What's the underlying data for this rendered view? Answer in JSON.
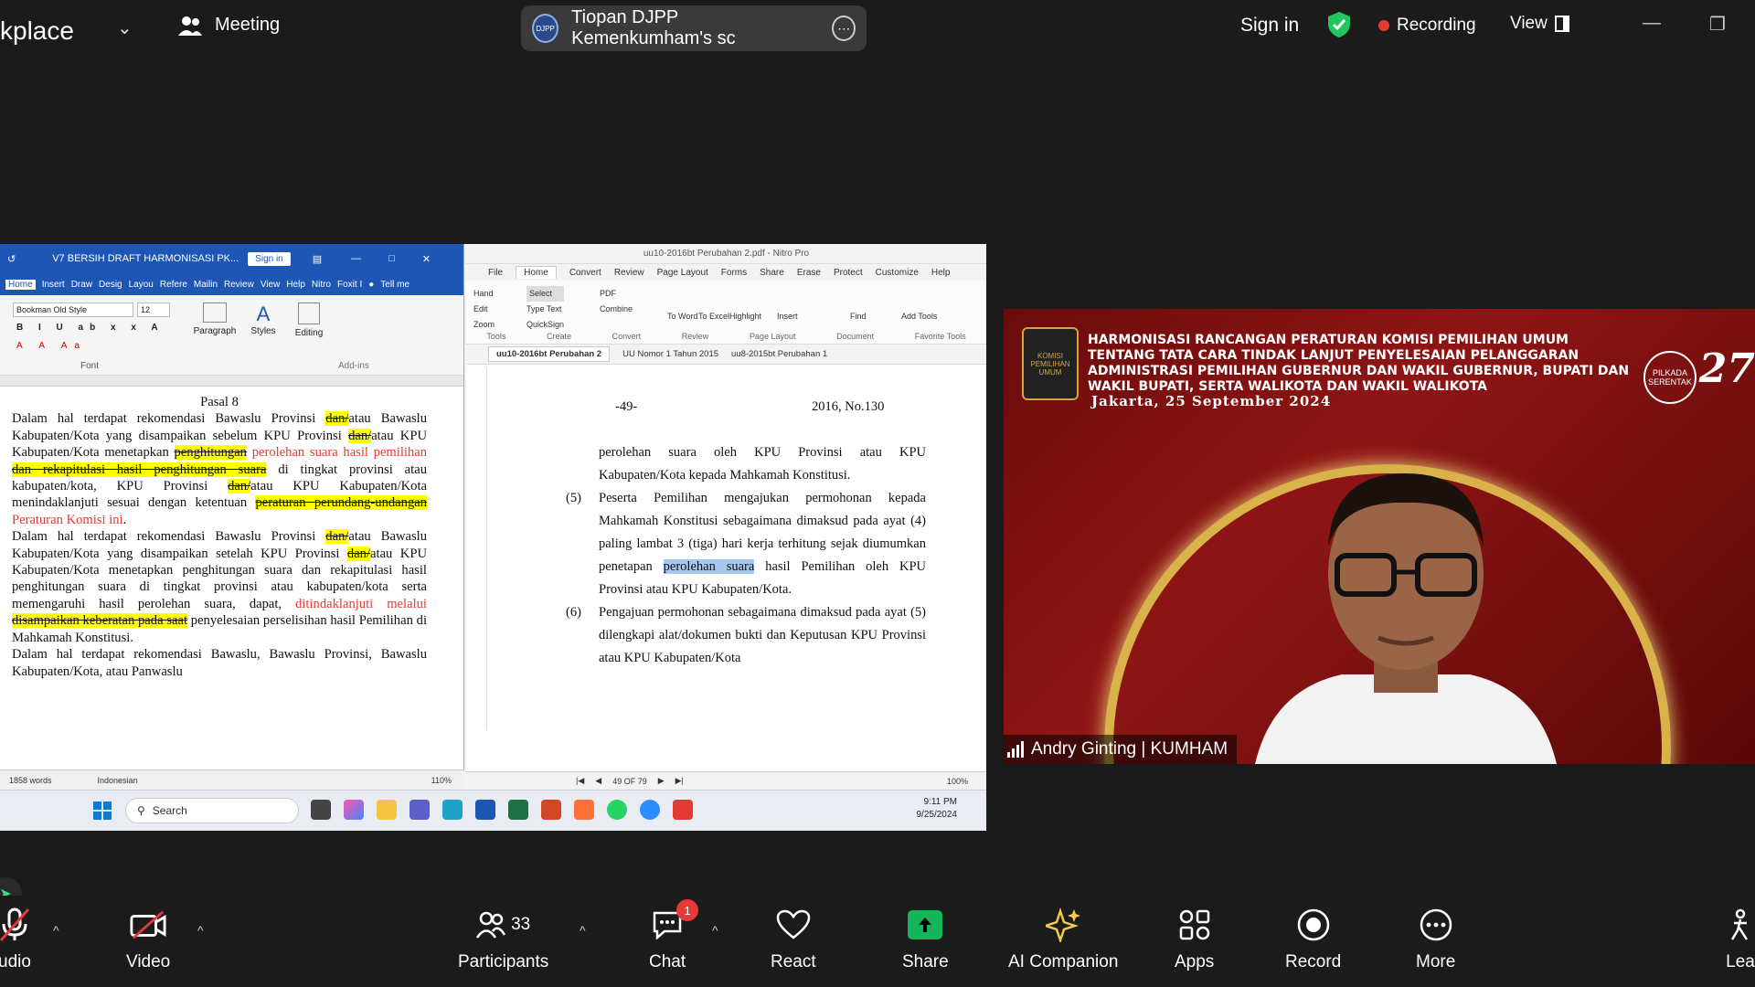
{
  "topbar": {
    "app_title": "kplace",
    "meeting_label": "Meeting",
    "share_pill_text": "Tiopan DJPP Kemenkumham's sc",
    "share_pill_logo": "DJPP",
    "signin": "Sign in",
    "recording": "Recording",
    "view": "View"
  },
  "word": {
    "title": "V7 BERSIH DRAFT HARMONISASI PK...",
    "signin": "Sign in",
    "tabs": [
      "Home",
      "Insert",
      "Draw",
      "Desig",
      "Layou",
      "Refere",
      "Mailin",
      "Review",
      "View",
      "Help",
      "Nitro",
      "Foxit I"
    ],
    "tell_me": "Tell me",
    "font_name": "Bookman Old Style",
    "font_size": "12",
    "groups": [
      "Font",
      "Paragraph",
      "Styles",
      "Editing",
      "Add-ins"
    ],
    "heading": "Pasal 8",
    "status_words": "1858 words",
    "status_lang": "Indonesian",
    "status_zoom": "110%"
  },
  "nitro": {
    "title": "uu10-2016bt Perubahan 2.pdf - Nitro Pro",
    "tabs": [
      "File",
      "Home",
      "Convert",
      "Review",
      "Page Layout",
      "Forms",
      "Share",
      "Erase",
      "Protect",
      "Customize",
      "Help"
    ],
    "ribbon": [
      "Hand",
      "Edit",
      "Zoom",
      "Select",
      "Type Text",
      "QuickSign",
      "PDF",
      "Combine",
      "To Word",
      "To Excel",
      "Highlight",
      "Insert",
      "Find",
      "Add Tools"
    ],
    "groups": [
      "Tools",
      "Create",
      "Convert",
      "Review",
      "Page Layout",
      "Document",
      "Favorite Tools"
    ],
    "doc_tabs": [
      "uu10-2016bt Perubahan 2",
      "UU Nomor 1 Tahun 2015",
      "uu8-2015bt Perubahan 1"
    ],
    "page_number": "-49-",
    "page_header": "2016, No.130",
    "para_intro": "perolehan suara oleh KPU Provinsi atau KPU Kabupaten/Kota kepada Mahkamah Konstitusi.",
    "item5_num": "(5)",
    "item5_a": "Peserta Pemilihan mengajukan permohonan kepada Mahkamah Konstitusi sebagaimana dimaksud pada ayat (4) paling lambat 3 (tiga) hari kerja terhitung sejak diumumkan penetapan",
    "item5_sel": "perolehan suara",
    "item5_b": "hasil Pemilihan oleh KPU Provinsi atau KPU Kabupaten/Kota.",
    "item6_num": "(6)",
    "item6": "Pengajuan permohonan sebagaimana dimaksud pada ayat (5) dilengkapi alat/dokumen bukti dan Keputusan KPU Provinsi atau KPU Kabupaten/Kota",
    "page_indicator": "49 OF 79",
    "zoom": "100%"
  },
  "taskbar": {
    "search": "Search",
    "time": "9:11 PM",
    "date": "9/25/2024"
  },
  "video": {
    "banner": "HARMONISASI RANCANGAN PERATURAN KOMISI PEMILIHAN UMUM TENTANG TATA CARA TINDAK LANJUT PENYELESAIAN PELANGGARAN ADMINISTRASI PEMILIHAN GUBERNUR DAN WAKIL GUBERNUR, BUPATI DAN WAKIL BUPATI, SERTA WALIKOTA DAN WAKIL WALIKOTA",
    "date": "Jakarta, 25 September 2024",
    "logo_text": "KOMISI PEMILIHAN UMUM",
    "badge_text": "PILKADA SERENTAK",
    "badge_number": "27",
    "participant_name": "Andry Ginting | KUMHAM"
  },
  "toolbar": {
    "audio": "udio",
    "video": "Video",
    "participants": "Participants",
    "participants_count": "33",
    "chat": "Chat",
    "chat_badge": "1",
    "react": "React",
    "share": "Share",
    "ai": "AI Companion",
    "apps": "Apps",
    "record": "Record",
    "more": "More",
    "leave": "Lea"
  },
  "colors": {
    "share_green": "#16b55a",
    "record_red": "#e53935",
    "word_blue": "#1d56b5",
    "highlight": "#ffff00",
    "banner_red": "#8f1515"
  }
}
